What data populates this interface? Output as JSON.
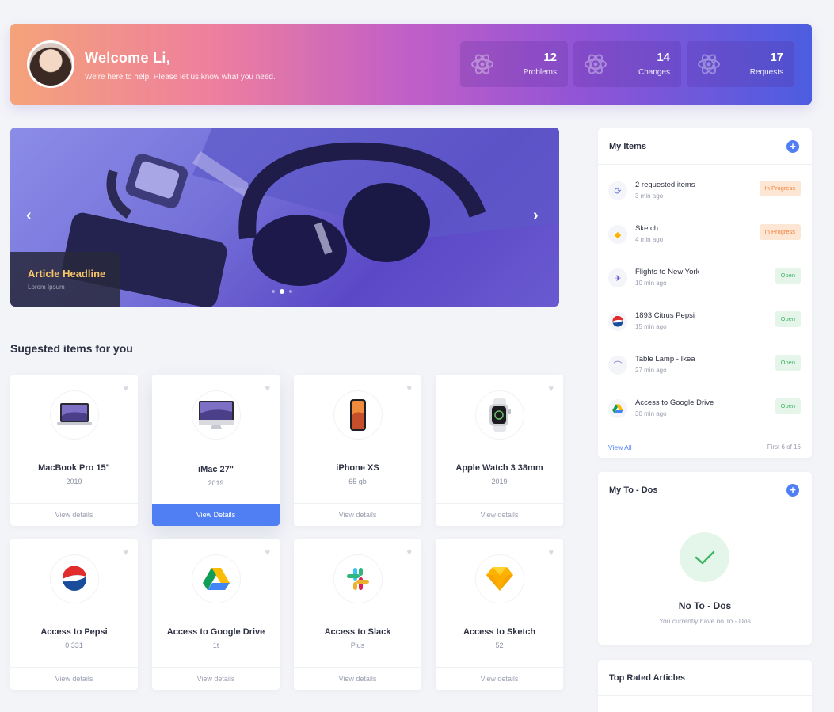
{
  "header": {
    "title": "Welcome Li,",
    "subtitle": "We're here to help. Please let us know what you need.",
    "stats": [
      {
        "value": "12",
        "label": "Problems",
        "icon": "atom-icon"
      },
      {
        "value": "14",
        "label": "Changes",
        "icon": "atom-icon"
      },
      {
        "value": "17",
        "label": "Requests",
        "icon": "atom-icon"
      }
    ]
  },
  "hero": {
    "article_title": "Article Headline",
    "article_sub": "Lorem Ipsum",
    "prev_icon": "chevron-left-icon",
    "next_icon": "chevron-right-icon",
    "slides": 3,
    "active_slide": 2
  },
  "suggested": {
    "title": "Sugested items for you",
    "items": [
      {
        "name": "MacBook Pro 15\"",
        "sub": "2019",
        "action": "View details",
        "icon": "laptop-icon"
      },
      {
        "name": "iMac 27\"",
        "sub": "2019",
        "action": "View Details",
        "icon": "imac-icon",
        "active": true
      },
      {
        "name": "iPhone XS",
        "sub": "65 gb",
        "action": "View details",
        "icon": "iphone-icon"
      },
      {
        "name": "Apple Watch 3 38mm",
        "sub": "2019",
        "action": "View details",
        "icon": "watch-icon"
      },
      {
        "name": "Access to Pepsi",
        "sub": "0,331",
        "action": "View details",
        "icon": "pepsi-icon"
      },
      {
        "name": "Access to Google Drive",
        "sub": "1t",
        "action": "View details",
        "icon": "google-drive-icon"
      },
      {
        "name": "Access to Slack",
        "sub": "Plus",
        "action": "View details",
        "icon": "slack-icon"
      },
      {
        "name": "Access to Sketch",
        "sub": "52",
        "action": "View details",
        "icon": "sketch-icon"
      }
    ]
  },
  "my_items": {
    "title": "My Items",
    "list": [
      {
        "title": "2 requested items",
        "time": "3 min ago",
        "status": "In Progress",
        "icon": "refresh-icon"
      },
      {
        "title": "Sketch",
        "time": "4 min ago",
        "status": "In Progress",
        "icon": "sketch-icon"
      },
      {
        "title": "Flights to New York",
        "time": "10 min ago",
        "status": "Open",
        "icon": "plane-icon"
      },
      {
        "title": "1893 Citrus Pepsi",
        "time": "15 min ago",
        "status": "Open",
        "icon": "pepsi-icon"
      },
      {
        "title": "Table Lamp - Ikea",
        "time": "27 min ago",
        "status": "Open",
        "icon": "lamp-icon"
      },
      {
        "title": "Access to Google Drive",
        "time": "30 min ago",
        "status": "Open",
        "icon": "google-drive-icon"
      }
    ],
    "view_all": "View All",
    "paging": "First 6 of 16"
  },
  "todos": {
    "title": "My To - Dos",
    "empty_title": "No To - Dos",
    "empty_sub": "You currently have no To - Dos"
  },
  "top_rated": {
    "title": "Top Rated Articles"
  },
  "colors": {
    "accent": "#4f7ff3",
    "in_progress": "#f0813a",
    "open": "#42b667"
  }
}
